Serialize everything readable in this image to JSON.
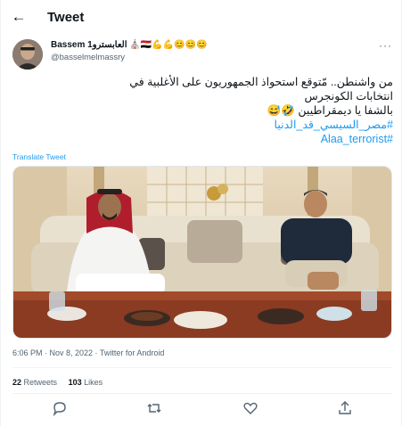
{
  "header": {
    "back_glyph": "←",
    "title": "Tweet"
  },
  "author": {
    "display_name": "Bassem العابسترو1 ⛪🇪🇬💪💪😊😊😊",
    "handle": "@basselmelmassry",
    "more_glyph": "···"
  },
  "tweet": {
    "lines": [
      "من واشنطن..  مّتوقع استحواذ الجمهوريون على الأغلبية في",
      "انتخابات الكونجرس",
      "بالشفا يا ديمقراطيين 🤣😅"
    ],
    "hashtags": [
      "#مصر_السيسي_قد_الدنيا",
      "#Alaa_terrorist"
    ],
    "translate_label": "Translate Tweet"
  },
  "meta": {
    "timestamp": "6:06 PM · Nov 8, 2022 · Twitter for Android"
  },
  "stats": {
    "retweets_count": "22",
    "retweets_label": "Retweets",
    "likes_count": "103",
    "likes_label": "Likes"
  },
  "colors": {
    "accent": "#1d9bf0",
    "muted": "#536471",
    "text": "#0f1419",
    "divider": "#eff3f4"
  },
  "icons": {
    "reply": "reply-icon",
    "retweet": "retweet-icon",
    "like": "like-icon",
    "share": "share-icon"
  }
}
